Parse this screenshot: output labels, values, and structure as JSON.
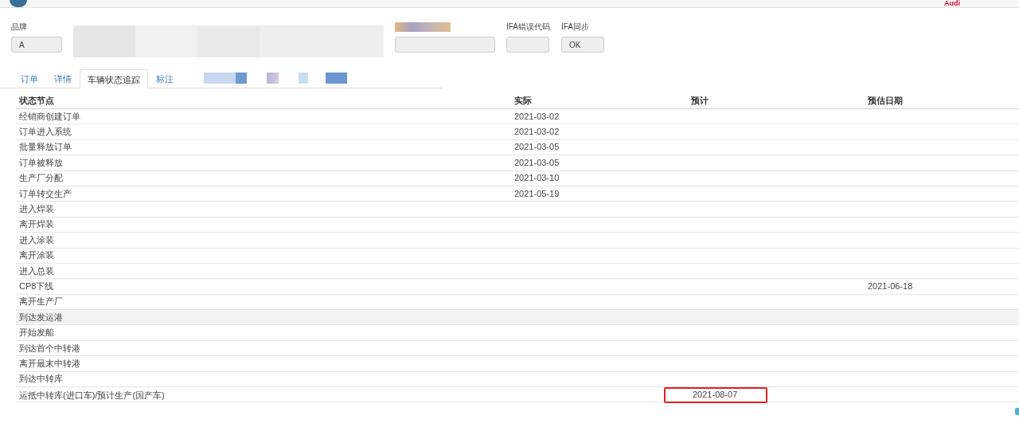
{
  "header": {
    "brand": "Audi"
  },
  "form": {
    "fields": [
      {
        "kind": "field",
        "label": "品牌",
        "value": "A"
      },
      {
        "kind": "redacted"
      },
      {
        "kind": "redacted-field"
      },
      {
        "kind": "field",
        "label": "IFA错误代码"
      },
      {
        "kind": "field",
        "label": "IFA同步",
        "value": "OK"
      }
    ]
  },
  "tabs": [
    {
      "label": "订单",
      "selected": false
    },
    {
      "label": "详情",
      "selected": false
    },
    {
      "label": "车辆状态追踪",
      "selected": true
    },
    {
      "label": "标注",
      "selected": false
    }
  ],
  "table": {
    "columns": [
      "状态节点",
      "实际",
      "预计",
      "预估日期"
    ],
    "rows": [
      {
        "cells": [
          "经销商创建订单",
          "2021-03-02",
          "",
          ""
        ],
        "highlighted": false,
        "boxed": false
      },
      {
        "cells": [
          "订单进入系统",
          "2021-03-02",
          "",
          ""
        ],
        "highlighted": false,
        "boxed": false
      },
      {
        "cells": [
          "批量释放订单",
          "2021-03-05",
          "",
          ""
        ],
        "highlighted": false,
        "boxed": false
      },
      {
        "cells": [
          "订单被释放",
          "2021-03-05",
          "",
          ""
        ],
        "highlighted": false,
        "boxed": false
      },
      {
        "cells": [
          "生产厂分配",
          "2021-03-10",
          "",
          ""
        ],
        "highlighted": false,
        "boxed": false
      },
      {
        "cells": [
          "订单转交生产",
          "2021-05-19",
          "",
          ""
        ],
        "highlighted": false,
        "boxed": false
      },
      {
        "cells": [
          "进入焊装",
          "",
          "",
          ""
        ],
        "highlighted": false,
        "boxed": false
      },
      {
        "cells": [
          "离开焊装",
          "",
          "",
          ""
        ],
        "highlighted": false,
        "boxed": false
      },
      {
        "cells": [
          "进入涂装",
          "",
          "",
          ""
        ],
        "highlighted": false,
        "boxed": false
      },
      {
        "cells": [
          "离开涂装",
          "",
          "",
          ""
        ],
        "highlighted": false,
        "boxed": false
      },
      {
        "cells": [
          "进入总装",
          "",
          "",
          ""
        ],
        "highlighted": false,
        "boxed": false
      },
      {
        "cells": [
          "CP8下线",
          "",
          "",
          "2021-06-18"
        ],
        "highlighted": false,
        "boxed": false
      },
      {
        "cells": [
          "离开生产厂",
          "",
          "",
          ""
        ],
        "highlighted": false,
        "boxed": false
      },
      {
        "cells": [
          "到达发运港",
          "",
          "",
          ""
        ],
        "highlighted": true,
        "boxed": false
      },
      {
        "cells": [
          "开始发船",
          "",
          "",
          ""
        ],
        "highlighted": false,
        "boxed": false
      },
      {
        "cells": [
          "到达首个中转港",
          "",
          "",
          ""
        ],
        "highlighted": false,
        "boxed": false
      },
      {
        "cells": [
          "离开最末中转港",
          "",
          "",
          ""
        ],
        "highlighted": false,
        "boxed": false
      },
      {
        "cells": [
          "到达中转库",
          "",
          "",
          ""
        ],
        "highlighted": false,
        "boxed": false
      },
      {
        "cells": [
          "运抵中转库(进口车)/预计生产(国产车)",
          "",
          "2021-08-07",
          ""
        ],
        "highlighted": false,
        "boxed": true
      }
    ]
  }
}
